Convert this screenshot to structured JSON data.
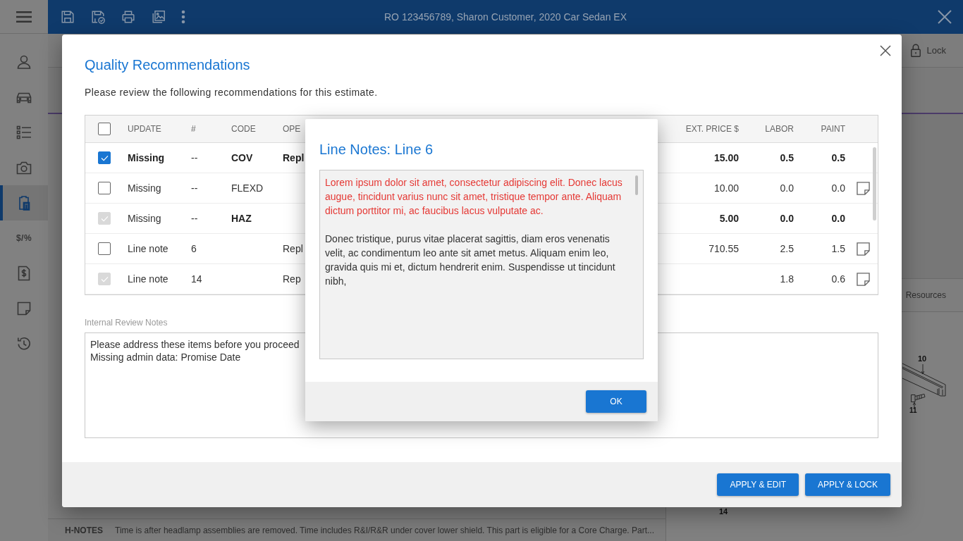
{
  "app_bar": {
    "title": "RO 123456789, Sharon Customer, 2020 Car Sedan EX"
  },
  "sidebar": {
    "items": [
      {
        "selected": false
      },
      {
        "selected": false
      },
      {
        "selected": false
      },
      {
        "selected": false
      },
      {
        "selected": true
      },
      {
        "selected": false,
        "glyph": "$/%"
      },
      {
        "selected": false
      },
      {
        "selected": false
      },
      {
        "selected": false
      }
    ]
  },
  "toolbar": {
    "lock_label": "Lock"
  },
  "side_panel": {
    "tabs": [
      {
        "label": "Resources"
      }
    ],
    "diagram": {
      "callouts": [
        "10",
        "11",
        "14"
      ]
    }
  },
  "h_notes": {
    "label": "H-NOTES",
    "text": "Time is after headlamp assemblies are removed. Time includes R&I/R&R under cover lower shield. This part is eligible for a Core Charge. Part..."
  },
  "quality_dialog": {
    "title": "Quality Recommendations",
    "subtitle": "Please review the following recommendations for this estimate.",
    "table": {
      "select_all": {
        "checked": false
      },
      "columns": [
        "UPDATE",
        "#",
        "CODE",
        "OPE",
        "EXT. PRICE $",
        "LABOR",
        "PAINT"
      ],
      "rows": [
        {
          "checked": true,
          "disabled": false,
          "note": false,
          "update": {
            "text": "Missing",
            "bold": true
          },
          "number": {
            "text": "--",
            "bold": false
          },
          "code": {
            "text": "COV",
            "bold": true
          },
          "operation": {
            "text": "Repl",
            "bold": true
          },
          "ext_price": {
            "text": "15.00",
            "bold": true
          },
          "labor": {
            "text": "0.5",
            "bold": true
          },
          "paint": {
            "text": "0.5",
            "bold": true
          }
        },
        {
          "checked": false,
          "disabled": false,
          "note": true,
          "update": {
            "text": "Missing",
            "bold": false
          },
          "number": {
            "text": "--",
            "bold": false
          },
          "code": {
            "text": "FLEXD",
            "bold": false
          },
          "ext_price": {
            "text": "10.00",
            "bold": false
          },
          "labor": {
            "text": "0.0",
            "bold": false
          },
          "paint": {
            "text": "0.0",
            "bold": false
          }
        },
        {
          "checked": true,
          "disabled": true,
          "note": false,
          "update": {
            "text": "Missing",
            "bold": false
          },
          "number": {
            "text": "--",
            "bold": false
          },
          "code": {
            "text": "HAZ",
            "bold": true
          },
          "ext_price": {
            "text": "5.00",
            "bold": true
          },
          "labor": {
            "text": "0.0",
            "bold": true
          },
          "paint": {
            "text": "0.0",
            "bold": true
          }
        },
        {
          "checked": false,
          "disabled": false,
          "note": true,
          "update": {
            "text": "Line note",
            "bold": false
          },
          "number": {
            "text": "6",
            "bold": false
          },
          "operation": {
            "text": "Repl",
            "bold": false
          },
          "ext_price": {
            "text": "710.55",
            "bold": false
          },
          "labor": {
            "text": "2.5",
            "bold": false
          },
          "paint": {
            "text": "1.5",
            "bold": false
          }
        },
        {
          "checked": true,
          "disabled": true,
          "note": true,
          "update": {
            "text": "Line note",
            "bold": false
          },
          "number": {
            "text": "14",
            "bold": false
          },
          "operation": {
            "text": "Rep",
            "bold": false
          },
          "labor": {
            "text": "1.8",
            "bold": false
          },
          "paint": {
            "text": "0.6",
            "bold": false
          }
        }
      ]
    },
    "notes": {
      "label": "Internal Review Notes",
      "value": "Please address these items before you proceed\nMissing admin data: Promise Date"
    },
    "buttons": [
      "APPLY & EDIT",
      "APPLY & LOCK"
    ]
  },
  "line_notes_dialog": {
    "title": "Line Notes: Line 6",
    "paragraphs": [
      {
        "text": "Lorem ipsum dolor sit amet, consectetur adipiscing elit. Donec lacus augue, tincidunt varius nunc sit amet, tristique tempor ante. Aliquam dictum porttitor mi, ac faucibus lacus vulputate ac.",
        "color": "#e53935"
      },
      {
        "text": "Donec tristique, purus vitae placerat sagittis, diam eros venenatis velit, ac condimentum leo ante sit amet metus. Aliquam enim leo, gravida quis mi et, dictum hendrerit enim. Suspendisse ut tincidunt nibh,",
        "color": "#333333"
      }
    ],
    "buttons": [
      "OK"
    ]
  }
}
